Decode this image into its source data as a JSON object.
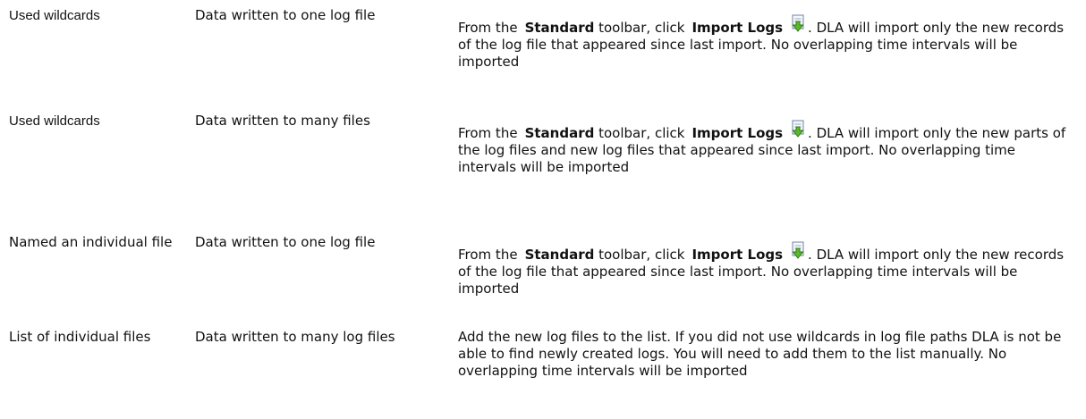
{
  "rows": [
    {
      "col1": "Used  wildcards",
      "col2": "Data written to one log file",
      "col3": {
        "prefix": "From the",
        "toolbar_name": "Standard",
        "mid": "toolbar, click",
        "button_name": "Import Logs",
        "icon": "import-logs-icon",
        "suffix": ". DLA will import only the new records of the log file that appeared since last import. No overlapping time intervals will be imported"
      }
    },
    {
      "col1": "Used  wildcards",
      "col2": "Data written to many files",
      "col3": {
        "prefix": "From the",
        "toolbar_name": "Standard",
        "mid": "toolbar, click",
        "button_name": "Import Logs",
        "icon": "import-logs-icon",
        "suffix": ". DLA will import only the new parts of the log files and new log files that appeared since last import. No overlapping time intervals will be imported"
      }
    },
    {
      "col1": "Named an individual file",
      "col2": "Data written to one log file",
      "col3": {
        "prefix": "From the",
        "toolbar_name": "Standard",
        "mid": "toolbar, click",
        "button_name": "Import Logs",
        "icon": "import-logs-icon",
        "suffix": ". DLA will import only the new records of the log file that appeared since last import. No overlapping time intervals will be imported"
      }
    },
    {
      "col1": "List of individual files",
      "col2": "Data written to many log files",
      "col3": {
        "text": "Add the new log files to the list. If you did not use  wildcards in log file paths DLA is not be able to find newly created logs. You will need to add them to the list manually. No overlapping time intervals will be imported"
      }
    }
  ]
}
